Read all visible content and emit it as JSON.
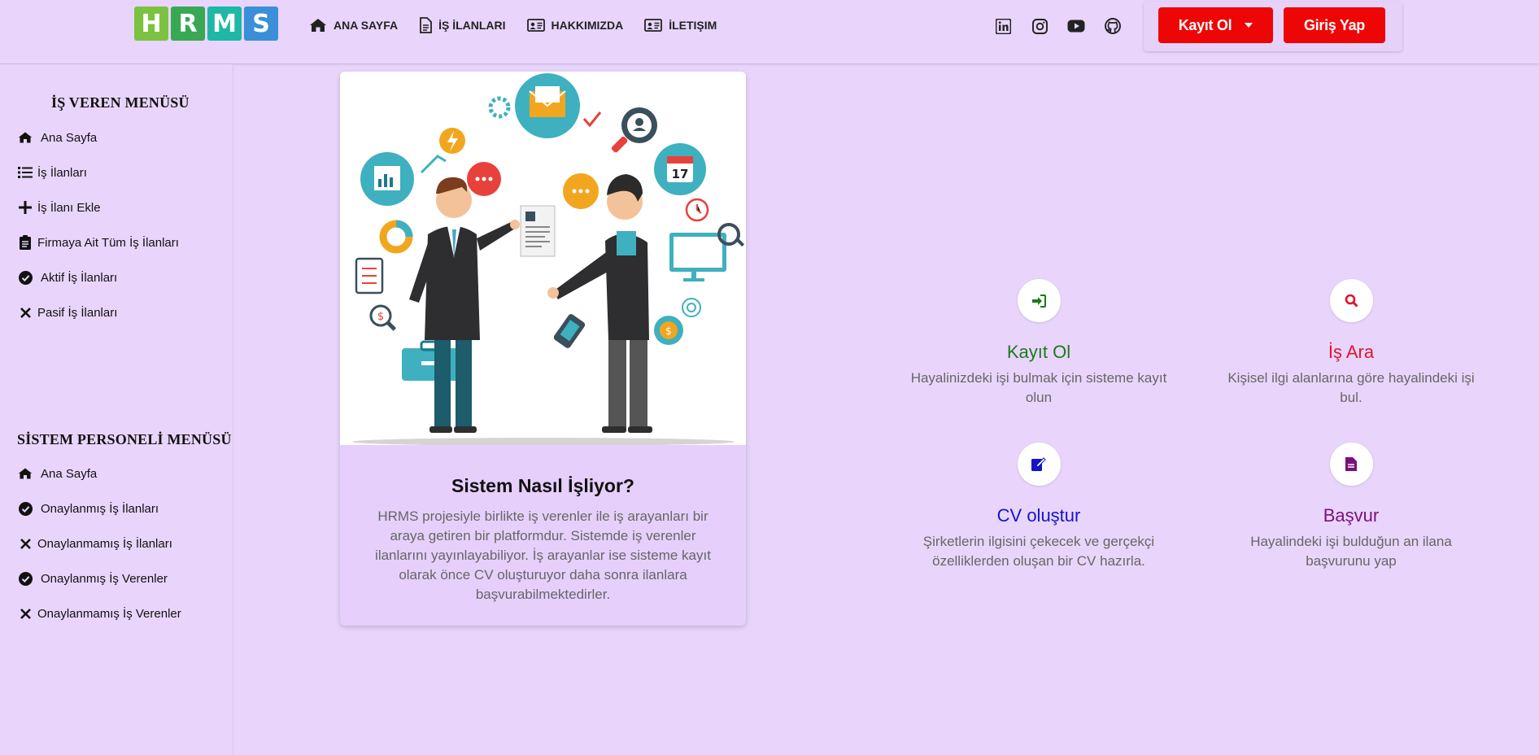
{
  "logo": {
    "letters": [
      "H",
      "R",
      "M",
      "S"
    ],
    "colors": [
      "#7cc242",
      "#38a853",
      "#1fb7a6",
      "#3a8fd8"
    ]
  },
  "nav": [
    {
      "label": "ANA SAYFA",
      "icon": "home-icon"
    },
    {
      "label": "İŞ İLANLARI",
      "icon": "file-icon"
    },
    {
      "label": "HAKKIMIZDA",
      "icon": "id-card-icon"
    },
    {
      "label": "İLETIŞIM",
      "icon": "address-card-icon"
    }
  ],
  "social": [
    "linkedin-icon",
    "instagram-icon",
    "youtube-icon",
    "github-icon"
  ],
  "auth": {
    "register": "Kayıt Ol",
    "login": "Giriş Yap"
  },
  "sidebar": {
    "employer_title": "İŞ VEREN MENÜSÜ",
    "employer_items": [
      {
        "label": "Ana Sayfa",
        "icon": "home-icon"
      },
      {
        "label": "İş İlanları",
        "icon": "list-icon"
      },
      {
        "label": "İş İlanı Ekle",
        "icon": "plus-icon"
      },
      {
        "label": "Firmaya Ait Tüm İş İlanları",
        "icon": "clipboard-icon"
      },
      {
        "label": "Aktif İş İlanları",
        "icon": "check-circle-icon"
      },
      {
        "label": "Pasif İş İlanları",
        "icon": "x-icon"
      }
    ],
    "staff_title": "SİSTEM PERSONELİ MENÜSÜ",
    "staff_items": [
      {
        "label": "Ana Sayfa",
        "icon": "home-icon"
      },
      {
        "label": "Onaylanmış İş İlanları",
        "icon": "check-circle-icon"
      },
      {
        "label": "Onaylanmamış İş İlanları",
        "icon": "x-icon"
      },
      {
        "label": "Onaylanmış İş Verenler",
        "icon": "check-circle-icon"
      },
      {
        "label": "Onaylanmamış İş Verenler",
        "icon": "x-icon"
      }
    ]
  },
  "card": {
    "title": "Sistem Nasıl İşliyor?",
    "description": "HRMS projesiyle birlikte iş verenler ile iş arayanları bir araya getiren bir platformdur. Sistemde iş verenler ilanlarını yayınlayabiliyor. İş arayanlar ise sisteme kayıt olarak önce CV oluşturuyor daha sonra ilanlara başvurabilmektedirler."
  },
  "features": [
    {
      "title": "Kayıt Ol",
      "desc": "Hayalinizdeki işi bulmak için sisteme kayıt olun",
      "color": "#1a7a1a",
      "icon": "sign-in-icon"
    },
    {
      "title": "İş Ara",
      "desc": "Kişisel ilgi alanlarına göre hayalindeki işi bul.",
      "color": "#e0142b",
      "icon": "search-icon"
    },
    {
      "title": "CV oluştur",
      "desc": "Şirketlerin ilgisini çekecek ve gerçekçi özelliklerden oluşan bir CV hazırla.",
      "color": "#1414c8",
      "icon": "edit-icon"
    },
    {
      "title": "Başvur",
      "desc": "Hayalindeki işi bulduğun an ilana başvurunu yap",
      "color": "#7a117a",
      "icon": "document-icon"
    }
  ],
  "colors": {
    "background": "#e9d5fb",
    "accent_red": "#ee0606"
  }
}
